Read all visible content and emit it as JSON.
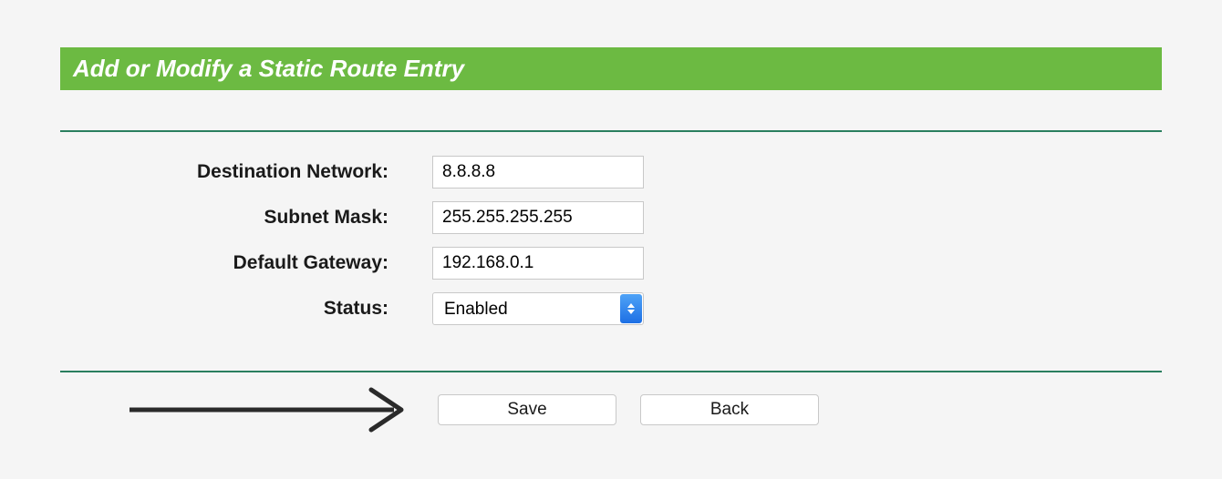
{
  "header": {
    "title": "Add or Modify a Static Route Entry"
  },
  "form": {
    "destination_network": {
      "label": "Destination Network:",
      "value": "8.8.8.8"
    },
    "subnet_mask": {
      "label": "Subnet Mask:",
      "value": "255.255.255.255"
    },
    "default_gateway": {
      "label": "Default Gateway:",
      "value": "192.168.0.1"
    },
    "status": {
      "label": "Status:",
      "selected": "Enabled"
    }
  },
  "buttons": {
    "save": "Save",
    "back": "Back"
  }
}
